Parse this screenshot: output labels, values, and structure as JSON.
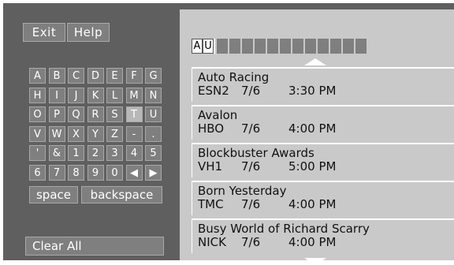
{
  "colors": {
    "panel": "#5f5f5f",
    "key": "#7f7f7f",
    "list": "#c9c9c9",
    "selected_key": "#b8b8b8"
  },
  "toolbar": {
    "exit_label": "Exit",
    "help_label": "Help"
  },
  "keyboard": {
    "rows": [
      [
        "A",
        "B",
        "C",
        "D",
        "E",
        "F",
        "G"
      ],
      [
        "H",
        "I",
        "J",
        "K",
        "L",
        "M",
        "N"
      ],
      [
        "O",
        "P",
        "Q",
        "R",
        "S",
        "T",
        "U"
      ],
      [
        "V",
        "W",
        "X",
        "Y",
        "Z",
        "-",
        "."
      ],
      [
        "'",
        "&",
        "1",
        "2",
        "3",
        "4",
        "5"
      ],
      [
        "6",
        "7",
        "8",
        "9",
        "0",
        "◀",
        "▶"
      ]
    ],
    "selected_key": "T",
    "space_label": "space",
    "backspace_label": "backspace",
    "clear_label": "Clear All"
  },
  "search": {
    "typed": [
      "A",
      "U"
    ],
    "remaining_slots": 12
  },
  "results": [
    {
      "title": "Auto Racing",
      "channel": "ESN2",
      "date": "7/6",
      "time": "3:30 PM"
    },
    {
      "title": "Avalon",
      "channel": "HBO",
      "date": "7/6",
      "time": "4:00 PM"
    },
    {
      "title": "Blockbuster Awards",
      "channel": "VH1",
      "date": "7/6",
      "time": "5:00 PM"
    },
    {
      "title": "Born Yesterday",
      "channel": "TMC",
      "date": "7/6",
      "time": "4:00 PM"
    },
    {
      "title": "Busy World of Richard Scarry",
      "channel": "NICK",
      "date": "7/6",
      "time": "4:00 PM"
    }
  ],
  "icons": {
    "scroll_up": "up-arrow-icon",
    "scroll_down": "down-arrow-icon"
  }
}
